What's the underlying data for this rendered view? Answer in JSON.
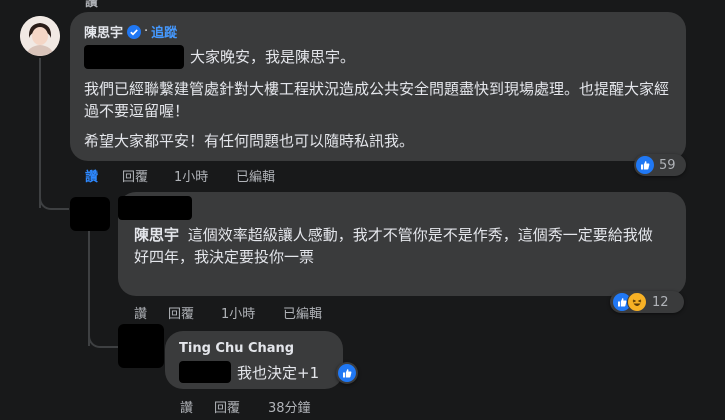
{
  "top_actions": {
    "like_label": "讚"
  },
  "comment1": {
    "author": "陳思宇",
    "follow": "追蹤",
    "line1": "大家晚安，我是陳思宇。",
    "para2": "我們已經聯繫建管處針對大樓工程狀況造成公共安全問題盡快到現場處理。也提醒大家經過不要逗留喔！",
    "para3": "希望大家都平安！有任何問題也可以隨時私訊我。",
    "reactions_count": "59",
    "actions": {
      "like": "讚",
      "reply": "回覆",
      "time": "1小時",
      "edited": "已編輯"
    }
  },
  "comment2": {
    "mention": "陳思宇",
    "text": "這個效率超級讓人感動，我才不管你是不是作秀，這個秀一定要給我做好四年，我決定要投你一票",
    "reactions_count": "12",
    "actions": {
      "like": "讚",
      "reply": "回覆",
      "time": "1小時",
      "edited": "已編輯"
    }
  },
  "comment3": {
    "author": "Ting Chu Chang",
    "text": "我也決定+1",
    "actions": {
      "like": "讚",
      "reply": "回覆",
      "time": "38分鐘"
    }
  },
  "colors": {
    "background": "#18191a",
    "bubble": "#3a3b3c",
    "like_blue": "#2078f4",
    "haha_yellow": "#f7b125"
  },
  "icons": [
    "verified-badge-icon",
    "like-reaction-icon",
    "haha-reaction-icon"
  ]
}
